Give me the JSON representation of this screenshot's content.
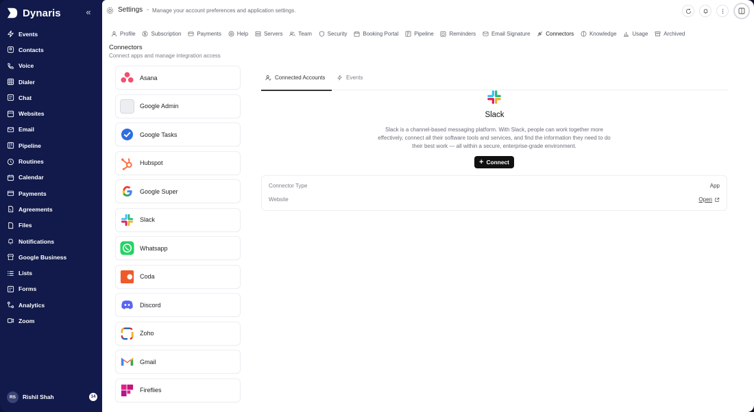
{
  "brand": {
    "name": "Dynaris"
  },
  "nav": [
    {
      "label": "Events",
      "icon": "bolt-icon"
    },
    {
      "label": "Contacts",
      "icon": "contacts-icon"
    },
    {
      "label": "Voice",
      "icon": "phone-icon"
    },
    {
      "label": "Dialer",
      "icon": "dialpad-icon"
    },
    {
      "label": "Chat",
      "icon": "chat-icon"
    },
    {
      "label": "Websites",
      "icon": "browser-icon"
    },
    {
      "label": "Email",
      "icon": "mail-icon"
    },
    {
      "label": "Pipeline",
      "icon": "pipeline-icon"
    },
    {
      "label": "Routines",
      "icon": "clock-icon"
    },
    {
      "label": "Calendar",
      "icon": "calendar-icon"
    },
    {
      "label": "Payments",
      "icon": "card-icon"
    },
    {
      "label": "Agreements",
      "icon": "document-icon"
    },
    {
      "label": "Files",
      "icon": "file-icon"
    },
    {
      "label": "Notifications",
      "icon": "bell-icon"
    },
    {
      "label": "Google Business",
      "icon": "store-icon"
    },
    {
      "label": "Lists",
      "icon": "list-icon"
    },
    {
      "label": "Forms",
      "icon": "form-icon"
    },
    {
      "label": "Analytics",
      "icon": "analytics-icon"
    },
    {
      "label": "Zoom",
      "icon": "video-icon"
    }
  ],
  "user": {
    "initials": "RS",
    "name": "Rishil Shah",
    "badge": "14"
  },
  "header": {
    "title": "Settings",
    "separator": "-",
    "subtitle": "Manage your account preferences and application settings."
  },
  "tabs": [
    {
      "label": "Profile"
    },
    {
      "label": "Subscription"
    },
    {
      "label": "Payments"
    },
    {
      "label": "Help"
    },
    {
      "label": "Servers"
    },
    {
      "label": "Team"
    },
    {
      "label": "Security"
    },
    {
      "label": "Booking Portal"
    },
    {
      "label": "Pipeline"
    },
    {
      "label": "Reminders"
    },
    {
      "label": "Email Signature"
    },
    {
      "label": "Connectors"
    },
    {
      "label": "Knowledge"
    },
    {
      "label": "Usage"
    },
    {
      "label": "Archived"
    }
  ],
  "page": {
    "title": "Connectors",
    "subtitle": "Connect apps and manage integration access"
  },
  "connectors": [
    {
      "label": "Asana"
    },
    {
      "label": "Google Admin"
    },
    {
      "label": "Google Tasks"
    },
    {
      "label": "Hubspot"
    },
    {
      "label": "Google Super"
    },
    {
      "label": "Slack"
    },
    {
      "label": "Whatsapp"
    },
    {
      "label": "Coda"
    },
    {
      "label": "Discord"
    },
    {
      "label": "Zoho"
    },
    {
      "label": "Gmail"
    },
    {
      "label": "Fireflies"
    }
  ],
  "detail": {
    "tabs": [
      {
        "label": "Connected Accounts"
      },
      {
        "label": "Events"
      }
    ],
    "app_name": "Slack",
    "description": "Slack is a channel-based messaging platform. With Slack, people can work together more effectively, connect all their software tools and services, and find the information they need to do their best work — all within a secure, enterprise-grade environment.",
    "connect_label": "Connect",
    "info": [
      {
        "label": "Connector Type",
        "value": "App"
      },
      {
        "label": "Website",
        "value": "Open"
      }
    ]
  },
  "colors": {
    "sidebar": "#111a4a",
    "accent": "#111111"
  }
}
